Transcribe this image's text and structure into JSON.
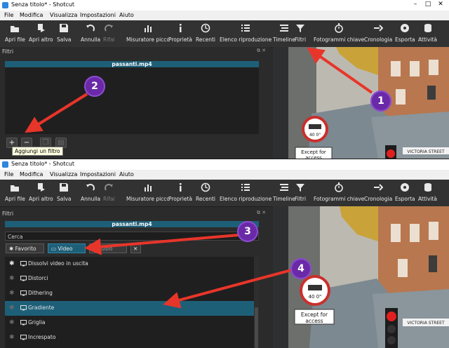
{
  "app": {
    "title": "Senza titolo* - Shotcut"
  },
  "menu": [
    "File",
    "Modifica",
    "Visualizza",
    "Impostazioni",
    "Aiuto"
  ],
  "toolbar": [
    {
      "label": "Apri file",
      "icon": "open-file-icon"
    },
    {
      "label": "Apri altro",
      "icon": "open-other-icon"
    },
    {
      "label": "Salva",
      "icon": "save-icon"
    },
    {
      "label": "Annulla",
      "icon": "undo-icon"
    },
    {
      "label": "Rifai",
      "icon": "redo-icon",
      "disabled": true
    },
    {
      "label": "Misuratore picco",
      "icon": "peak-meter-icon"
    },
    {
      "label": "Proprietà",
      "icon": "properties-icon"
    },
    {
      "label": "Recenti",
      "icon": "recent-icon"
    },
    {
      "label": "Elenco riproduzione",
      "icon": "playlist-icon"
    },
    {
      "label": "Timeline",
      "icon": "timeline-icon"
    },
    {
      "label": "Filtri",
      "icon": "filter-icon"
    },
    {
      "label": "Fotogrammi chiave",
      "icon": "keyframes-icon"
    },
    {
      "label": "Cronologia",
      "icon": "history-icon"
    },
    {
      "label": "Esporta",
      "icon": "export-icon"
    },
    {
      "label": "Attività",
      "icon": "jobs-icon"
    }
  ],
  "filters_panel": {
    "title": "Filtri",
    "file_name": "passanti.mp4",
    "add_tooltip": "Aggiungi un filtro",
    "search_placeholder": "Cerca",
    "tab_favorite": "Favorito",
    "tab_video": "Video",
    "tab_audio": "Audio"
  },
  "filter_list": [
    {
      "name": "Dissolvi video in uscita",
      "favorite": true,
      "selected": false
    },
    {
      "name": "Distorci",
      "favorite": false,
      "selected": false
    },
    {
      "name": "Dithering",
      "favorite": false,
      "selected": false
    },
    {
      "name": "Gradiente",
      "favorite": false,
      "selected": true
    },
    {
      "name": "Griglia",
      "favorite": false,
      "selected": false
    },
    {
      "name": "Increspato",
      "favorite": false,
      "selected": false
    }
  ],
  "video": {
    "sign_speed": "40 0\"",
    "sign_access": "Except for access",
    "street_sign": "VICTORIA STREET"
  },
  "annotations": [
    "1",
    "2",
    "3",
    "4"
  ],
  "colors": {
    "accent": "#1e5f78",
    "annotation_arrow": "#e8352a",
    "annotation_bubble": "#6a2aa8"
  }
}
